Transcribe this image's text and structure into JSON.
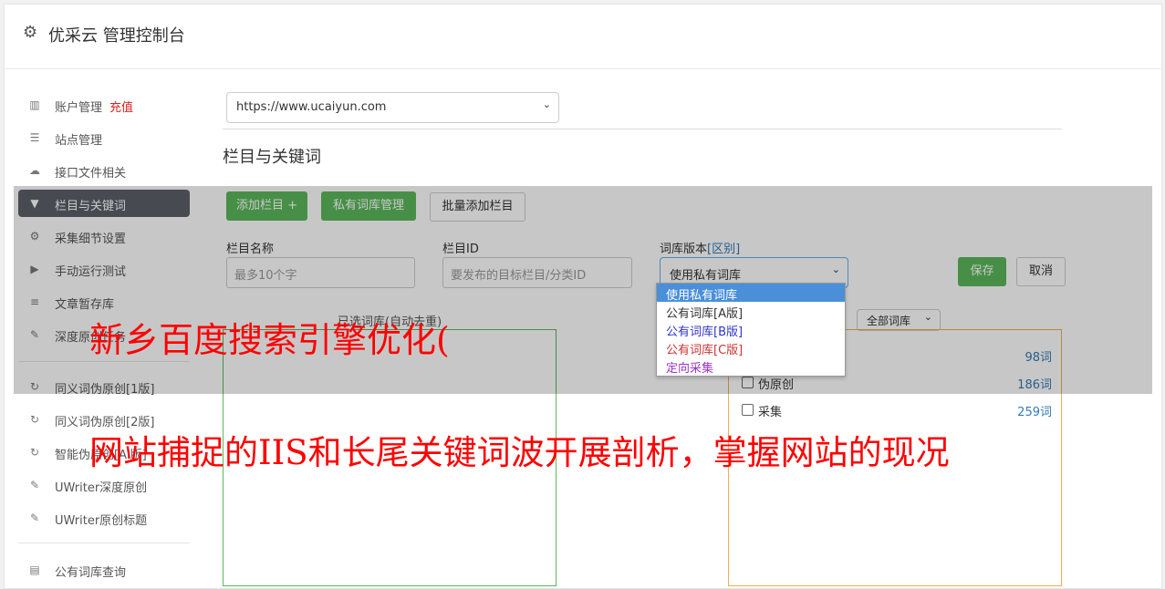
{
  "app": {
    "title": "优采云 管理控制台"
  },
  "sidebar": {
    "items": [
      {
        "icon": "bar-chart-icon",
        "glyph": "▥",
        "label": "账户管理",
        "badge": "充值"
      },
      {
        "icon": "server-icon",
        "glyph": "☰",
        "label": "站点管理"
      },
      {
        "icon": "cloud-upload-icon",
        "glyph": "☁",
        "label": "接口文件相关"
      },
      {
        "icon": "filter-icon",
        "glyph": "▼",
        "label": "栏目与关键词",
        "active": true
      },
      {
        "icon": "gears-icon",
        "glyph": "⚙",
        "label": "采集细节设置"
      },
      {
        "icon": "play-circle-icon",
        "glyph": "▶",
        "label": "手动运行测试"
      },
      {
        "icon": "database-icon",
        "glyph": "≡",
        "label": "文章暂存库"
      },
      {
        "icon": "edit-icon",
        "glyph": "✎",
        "label": "深度原创任务"
      },
      {
        "icon": "refresh-icon",
        "glyph": "↻",
        "label": "同义词伪原创[1版]"
      },
      {
        "icon": "refresh-icon",
        "glyph": "↻",
        "label": "同义词伪原创[2版]"
      },
      {
        "icon": "refresh-icon",
        "glyph": "↻",
        "label": "智能伪原创[AI版]"
      },
      {
        "icon": "edit-icon",
        "glyph": "✎",
        "label": "UWriter深度原创"
      },
      {
        "icon": "edit-icon",
        "glyph": "✎",
        "label": "UWriter原创标题"
      },
      {
        "icon": "book-icon",
        "glyph": "▤",
        "label": "公有词库查询"
      }
    ]
  },
  "site_select": {
    "value": "https://www.ucaiyun.com"
  },
  "section": {
    "title": "栏目与关键词"
  },
  "toolbar": {
    "add_column": "添加栏目 +",
    "private_lib": "私有词库管理",
    "batch_add": "批量添加栏目"
  },
  "form": {
    "name_label": "栏目名称",
    "name_placeholder": "最多10个字",
    "id_label": "栏目ID",
    "id_placeholder": "要发布的目标栏目/分类ID",
    "version_label": "词库版本",
    "version_link": "[区别]",
    "version_value": "使用私有词库",
    "save": "保存",
    "cancel": "取消"
  },
  "dropdown": {
    "options": [
      {
        "label": "使用私有词库",
        "color": "#ffffff",
        "selected": true
      },
      {
        "label": "公有词库[A版]",
        "color": "#333333"
      },
      {
        "label": "公有词库[B版]",
        "color": "#3333cc"
      },
      {
        "label": "公有词库[C版]",
        "color": "#cc3333"
      },
      {
        "label": "定向采集",
        "color": "#9933cc"
      }
    ]
  },
  "panels": {
    "selected_title": "已选词库(自动去重)",
    "filter_value": "全部词库",
    "libs": [
      {
        "name": "",
        "count": "98词"
      },
      {
        "name": "伪原创",
        "count": "186词"
      },
      {
        "name": "采集",
        "count": "259词"
      }
    ]
  },
  "overlay_text": {
    "line1": "新乡百度搜索引擎优化(",
    "line2": "网站捕捉的IIS和长尾关键词波开展剖析，掌握网站的现况"
  },
  "colors": {
    "green": "#5cb85c",
    "orange": "#f0ad4e",
    "active_nav": "#5b6068",
    "overlay_red": "#ff0000",
    "link": "#337ab7"
  }
}
